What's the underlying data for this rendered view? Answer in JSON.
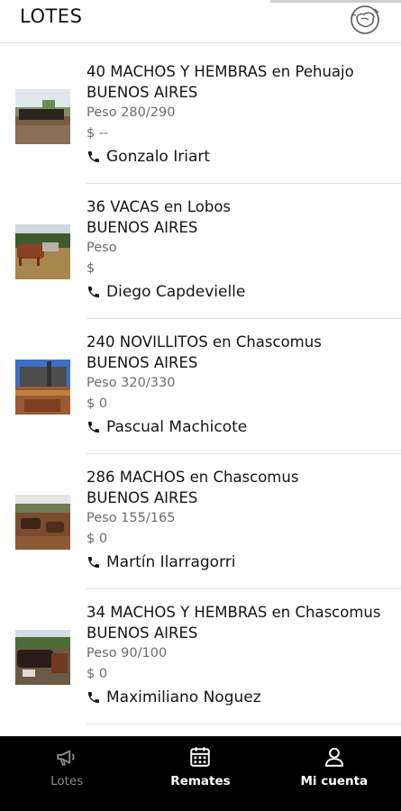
{
  "header": {
    "title": "LOTES",
    "logo_icon": "ranch-logo-icon"
  },
  "lots": [
    {
      "name": "40 MACHOS Y HEMBRAS en Pehuajo",
      "province": "BUENOS AIRES",
      "peso": "Peso 280/290",
      "precio": "$ --",
      "contact": "Gonzalo Iriart"
    },
    {
      "name": "36 VACAS en Lobos",
      "province": "BUENOS AIRES",
      "peso": "Peso",
      "precio": "$",
      "contact": "Diego Capdevielle"
    },
    {
      "name": "240 NOVILLITOS en Chascomus",
      "province": "BUENOS AIRES",
      "peso": "Peso 320/330",
      "precio": "$ 0",
      "contact": "Pascual Machicote"
    },
    {
      "name": "286 MACHOS en Chascomus",
      "province": "BUENOS AIRES",
      "peso": "Peso 155/165",
      "precio": "$ 0",
      "contact": "Martín Ilarragorri"
    },
    {
      "name": "34 MACHOS Y HEMBRAS en Chascomus",
      "province": "BUENOS AIRES",
      "peso": "Peso 90/100",
      "precio": "$ 0",
      "contact": "Maximiliano Noguez"
    }
  ],
  "nav": {
    "lotes": {
      "label": "Lotes",
      "icon": "megaphone-icon"
    },
    "remates": {
      "label": "Remates",
      "icon": "calendar-icon"
    },
    "cuenta": {
      "label": "Mi cuenta",
      "icon": "user-icon"
    }
  },
  "colors": {
    "nav_bg": "#000000",
    "nav_active": "#ffffff",
    "nav_inactive": "#8a8a8a",
    "muted_text": "#6c6c6c"
  }
}
